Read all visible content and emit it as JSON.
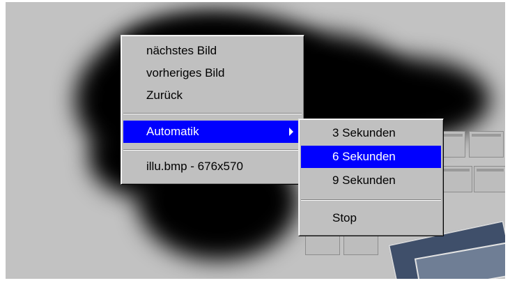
{
  "context_menu": {
    "items": [
      {
        "label": "nächstes Bild"
      },
      {
        "label": "vorheriges Bild"
      },
      {
        "label": "Zurück"
      },
      {
        "label": "Automatik"
      },
      {
        "label": "illu.bmp - 676x570"
      }
    ]
  },
  "submenu": {
    "items": [
      {
        "label": "3 Sekunden"
      },
      {
        "label": "6 Sekunden"
      },
      {
        "label": "9 Sekunden"
      },
      {
        "label": "Stop"
      }
    ]
  },
  "colors": {
    "selection": "#0000ff",
    "menu_face": "#c0c0c0",
    "background": "#c2c2c2"
  }
}
